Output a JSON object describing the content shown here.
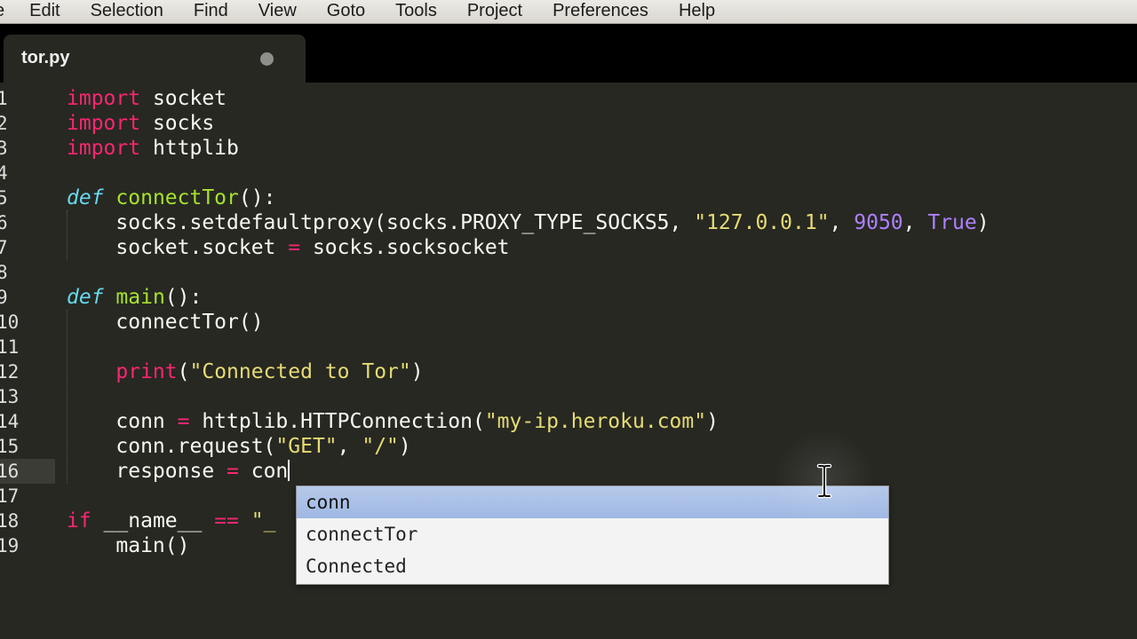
{
  "menubar": {
    "items": [
      "e",
      "Edit",
      "Selection",
      "Find",
      "View",
      "Goto",
      "Tools",
      "Project",
      "Preferences",
      "Help"
    ]
  },
  "tab": {
    "title": "tor.py"
  },
  "gutter": {
    "line_numbers": [
      "1",
      "2",
      "3",
      "4",
      "5",
      "6",
      "7",
      "8",
      "9",
      "10",
      "11",
      "12",
      "13",
      "14",
      "15",
      "16",
      "17",
      "18",
      "19"
    ]
  },
  "autocomplete": {
    "items": [
      "conn",
      "connectTor",
      "Connected"
    ]
  },
  "colors": {
    "background": "#272822",
    "keyword": "#f92672",
    "function": "#a6e22e",
    "string": "#e6db74",
    "number": "#ae81ff",
    "def": "#66d9ef",
    "selection": "#a9bfe6"
  },
  "icons": {
    "cursor": "ibeam-cursor-icon",
    "dirty": "unsaved-dot-icon"
  }
}
